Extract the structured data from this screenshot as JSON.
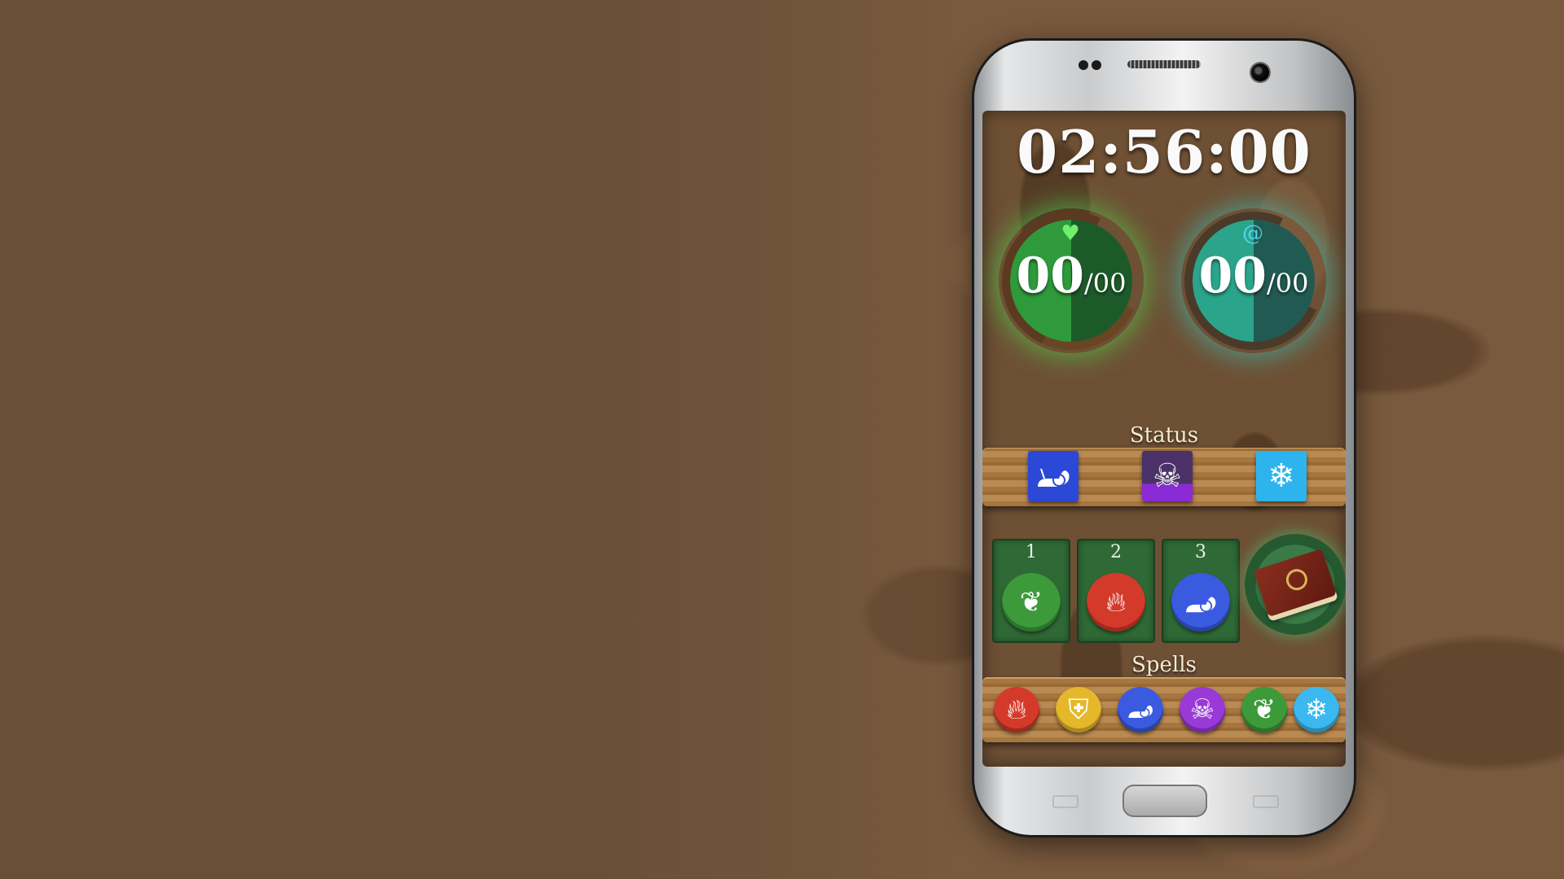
{
  "hud": {
    "timer": "02:56:00",
    "health": {
      "current": "00",
      "max": "/00",
      "icon": "heart-icon",
      "fill_fraction": 0.5,
      "color": "#2e9a3c"
    },
    "mana": {
      "current": "00",
      "max": "/00",
      "icon": "swirl-icon",
      "fill_fraction": 0.5,
      "color": "#2aa58c"
    }
  },
  "status": {
    "label": "Status",
    "effects": [
      {
        "icon": "snail-icon",
        "color": "#2b49d6"
      },
      {
        "icon": "skull-icon",
        "color": "#8a2bd6"
      },
      {
        "icon": "snowflake-icon",
        "color": "#2db4ef"
      }
    ]
  },
  "slots": [
    {
      "number": "1",
      "icon": "leaf-icon",
      "color": "#3c9a3a"
    },
    {
      "number": "2",
      "icon": "fire-icon",
      "color": "#d43a2a"
    },
    {
      "number": "3",
      "icon": "snail-icon",
      "color": "#3a5ae0"
    }
  ],
  "spellbook": {
    "icon": "spellbook-icon"
  },
  "spells": {
    "label": "Spells",
    "items": [
      {
        "icon": "fire-icon",
        "color": "#d43a2a"
      },
      {
        "icon": "shield-icon",
        "color": "#e4b82a"
      },
      {
        "icon": "snail-icon",
        "color": "#3a5ae0"
      },
      {
        "icon": "skull-icon",
        "color": "#9a3ad6"
      },
      {
        "icon": "leaf-icon",
        "color": "#3c9a3a"
      },
      {
        "icon": "snowflake-icon",
        "color": "#3ab8ef"
      }
    ]
  }
}
